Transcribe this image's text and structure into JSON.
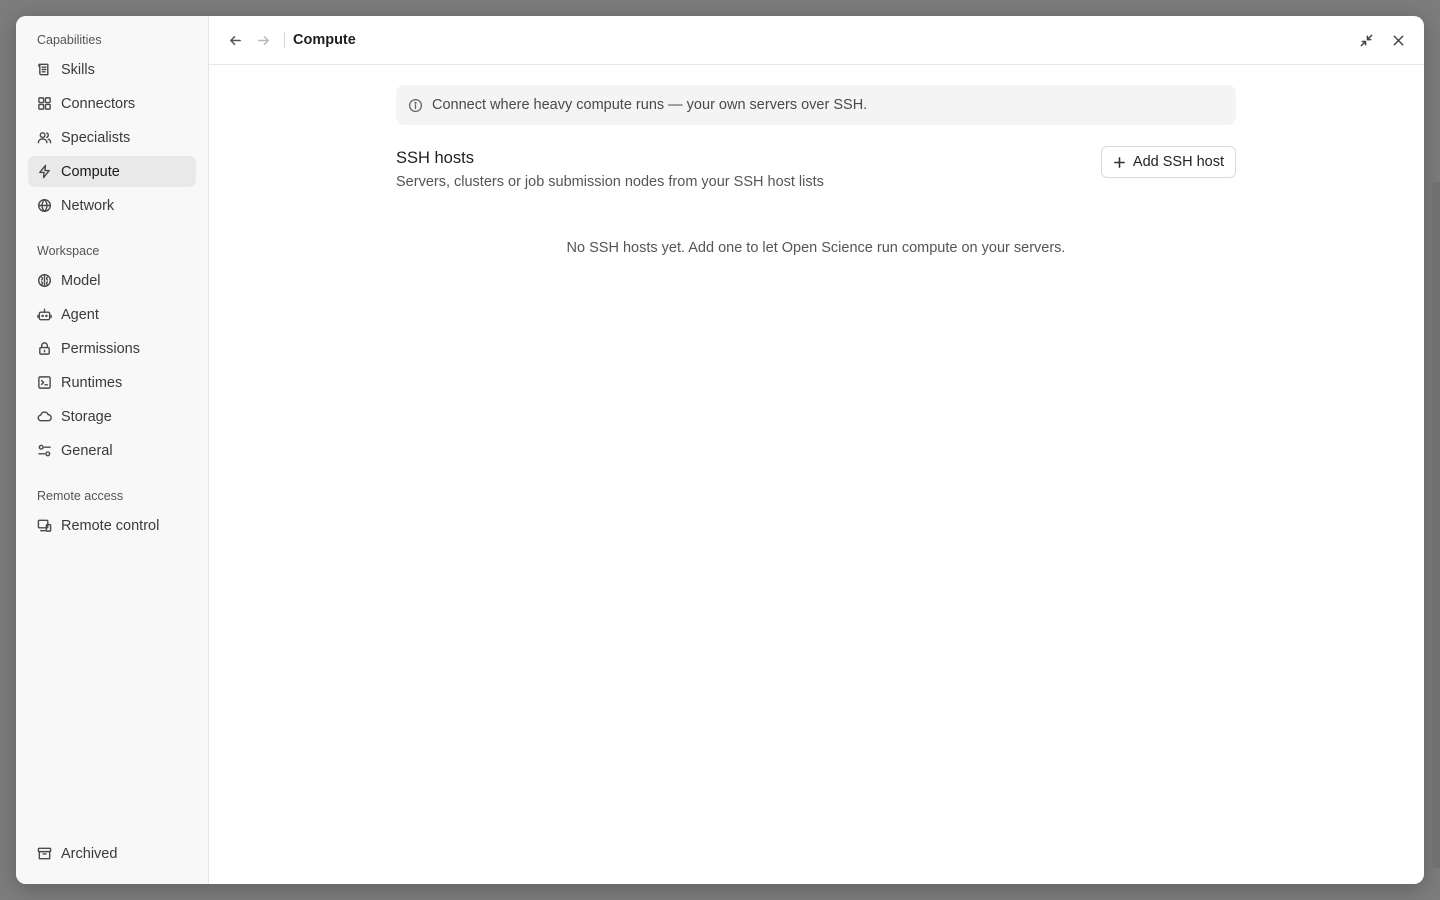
{
  "sidebar": {
    "capabilities_title": "Capabilities",
    "capabilities": [
      {
        "label": "Skills",
        "icon": "skills-icon"
      },
      {
        "label": "Connectors",
        "icon": "connectors-icon"
      },
      {
        "label": "Specialists",
        "icon": "specialists-icon"
      },
      {
        "label": "Compute",
        "icon": "lightning-icon",
        "active": true
      },
      {
        "label": "Network",
        "icon": "globe-icon"
      }
    ],
    "workspace_title": "Workspace",
    "workspace": [
      {
        "label": "Model",
        "icon": "brain-icon"
      },
      {
        "label": "Agent",
        "icon": "robot-icon"
      },
      {
        "label": "Permissions",
        "icon": "lock-icon"
      },
      {
        "label": "Runtimes",
        "icon": "terminal-icon"
      },
      {
        "label": "Storage",
        "icon": "cloud-icon"
      },
      {
        "label": "General",
        "icon": "sliders-icon"
      }
    ],
    "remote_title": "Remote access",
    "remote": [
      {
        "label": "Remote control",
        "icon": "devices-icon"
      }
    ],
    "bottom": {
      "label": "Archived",
      "icon": "archive-icon"
    }
  },
  "topbar": {
    "title": "Compute"
  },
  "main": {
    "info_banner": "Connect where heavy compute runs — your own servers over SSH.",
    "ssh_title": "SSH hosts",
    "ssh_desc": "Servers, clusters or job submission nodes from your SSH host lists",
    "add_button": "Add SSH host",
    "empty_text": "No SSH hosts yet. Add one to let Open Science run compute on your servers."
  }
}
